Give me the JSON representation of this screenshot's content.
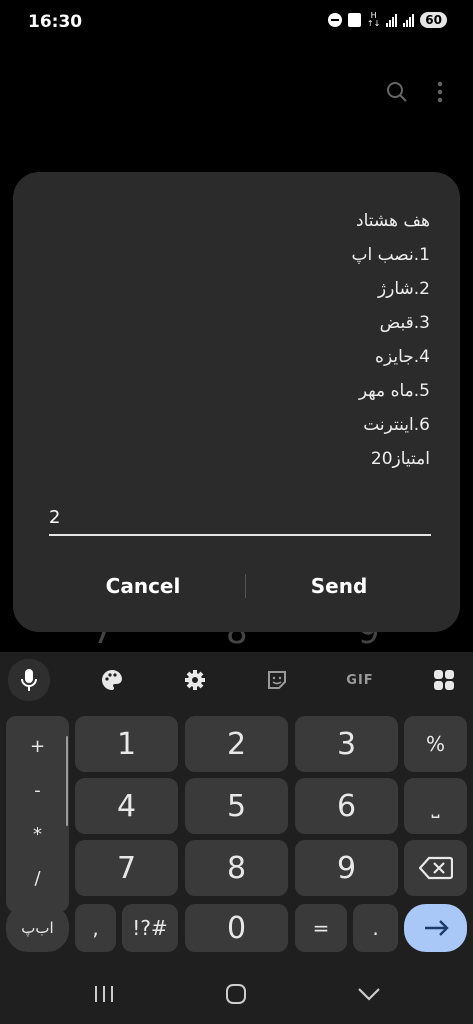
{
  "status_bar": {
    "time": "16:30",
    "battery": "60",
    "network": "H"
  },
  "dialog": {
    "lines": [
      "هف هشتاد",
      "1.نصب اپ",
      "2.شارژ",
      "3.قبض",
      "4.جایزه",
      "5.ماه مهر",
      "6.اینترنت",
      "امتیاز20"
    ],
    "input_value": "2",
    "cancel_label": "Cancel",
    "send_label": "Send"
  },
  "background_digits": [
    "7",
    "8",
    "9"
  ],
  "keyboard": {
    "toolbar": {
      "gif_label": "GIF"
    },
    "symbols": [
      "+",
      "-",
      "*",
      "/"
    ],
    "rows": [
      [
        "1",
        "2",
        "3",
        "%"
      ],
      [
        "4",
        "5",
        "6",
        "⎵"
      ],
      [
        "7",
        "8",
        "9"
      ]
    ],
    "bottom": {
      "lang": "اب‌پ",
      "comma": ",",
      "special": "!?#",
      "zero": "0",
      "equals": "=",
      "dot": "."
    }
  },
  "colors": {
    "accent": "#a9c8f7",
    "caret": "#3d7bff",
    "dialog_bg": "#2b2b2b",
    "key_bg": "#3a3a3a"
  }
}
